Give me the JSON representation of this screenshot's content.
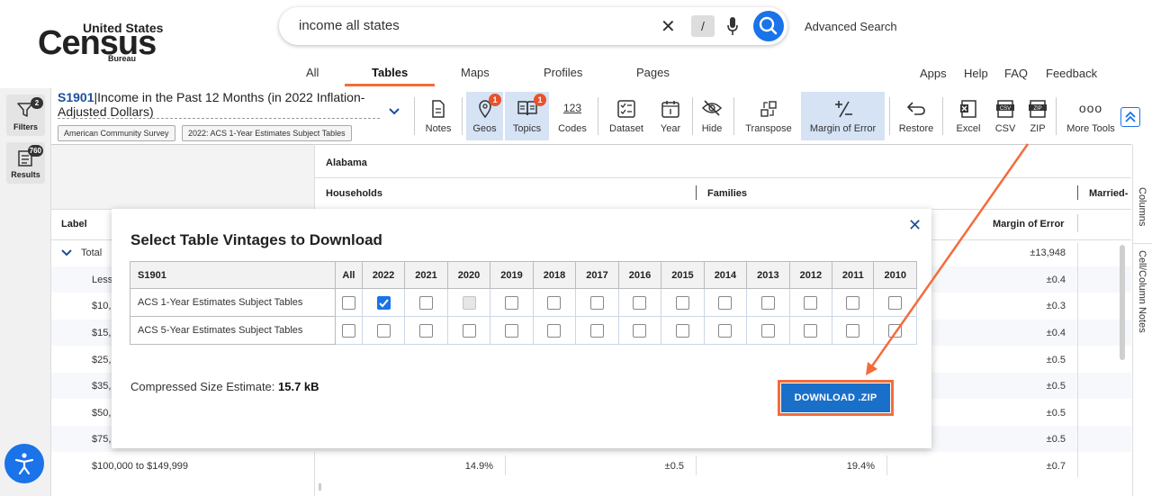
{
  "header": {
    "logo": {
      "line1": "United States",
      "line2": "Census",
      "line3": "Bureau"
    },
    "search": {
      "query": "income all states",
      "slash": "/"
    },
    "advanced_search": "Advanced Search",
    "tabs": [
      {
        "label": "All"
      },
      {
        "label": "Tables",
        "active": true
      },
      {
        "label": "Maps"
      },
      {
        "label": "Profiles"
      },
      {
        "label": "Pages"
      }
    ],
    "right_nav": [
      "Apps",
      "Help",
      "FAQ",
      "Feedback"
    ]
  },
  "left_rail": {
    "filters": {
      "label": "Filters",
      "badge": "2"
    },
    "results": {
      "label": "Results",
      "badge": "760"
    }
  },
  "table": {
    "id": "S1901",
    "title": "|Income in the Past 12 Months (in 2022 Inflation-Adjusted Dollars)",
    "chips": [
      "American Community Survey",
      "2022: ACS 1-Year Estimates Subject Tables"
    ]
  },
  "toolbar": {
    "notes": "Notes",
    "geos": {
      "label": "Geos",
      "badge": "1"
    },
    "topics": {
      "label": "Topics",
      "badge": "1"
    },
    "codes": {
      "label": "Codes",
      "glyph": "123"
    },
    "dataset": "Dataset",
    "year": "Year",
    "hide": "Hide",
    "transpose": "Transpose",
    "margin_of_error": "Margin of Error",
    "restore": "Restore",
    "excel": "Excel",
    "csv": "CSV",
    "zip": "ZIP",
    "more_tools": {
      "label": "More Tools",
      "glyph": "ooo"
    }
  },
  "grid": {
    "geo_header": "Alabama",
    "group_headers": [
      "Households",
      "Families",
      "Married-"
    ],
    "label_header": "Label",
    "moe_header": "Margin of Error",
    "rows": [
      {
        "label": "Total",
        "moe": "±13,948"
      },
      {
        "label": "Less",
        "moe": "±0.4"
      },
      {
        "label": "$10,",
        "moe": "±0.3"
      },
      {
        "label": "$15,",
        "moe": "±0.4"
      },
      {
        "label": "$25,",
        "moe": "±0.5"
      },
      {
        "label": "$35,",
        "moe": "±0.5"
      },
      {
        "label": "$50,",
        "moe": "±0.5"
      },
      {
        "label": "$75,",
        "moe": "±0.5"
      }
    ],
    "last_row": {
      "label": "$100,000 to $149,999",
      "v1": "14.9%",
      "v2": "±0.5",
      "v3": "19.4%",
      "moe": "±0.7"
    },
    "side_tabs": [
      "Columns",
      "Cell/Column Notes"
    ]
  },
  "modal": {
    "title": "Select Table Vintages to Download",
    "table_header": "S1901",
    "columns": [
      "All",
      "2022",
      "2021",
      "2020",
      "2019",
      "2018",
      "2017",
      "2016",
      "2015",
      "2014",
      "2013",
      "2012",
      "2011",
      "2010"
    ],
    "rows": [
      {
        "label": "ACS 1-Year Estimates Subject Tables",
        "checked": [
          "2022"
        ],
        "disabled": [
          "2020"
        ]
      },
      {
        "label": "ACS 5-Year Estimates Subject Tables",
        "checked": [],
        "disabled": []
      }
    ],
    "size_label": "Compressed Size Estimate: ",
    "size_value": "15.7 kB",
    "download_button": "DOWNLOAD .ZIP"
  },
  "colors": {
    "accent_blue": "#1a73e8",
    "download_blue": "#1a6fc9",
    "annotation_orange": "#f36d3b",
    "badge_red": "#e8512b",
    "selected_tool_bg": "#d5e3f5"
  }
}
